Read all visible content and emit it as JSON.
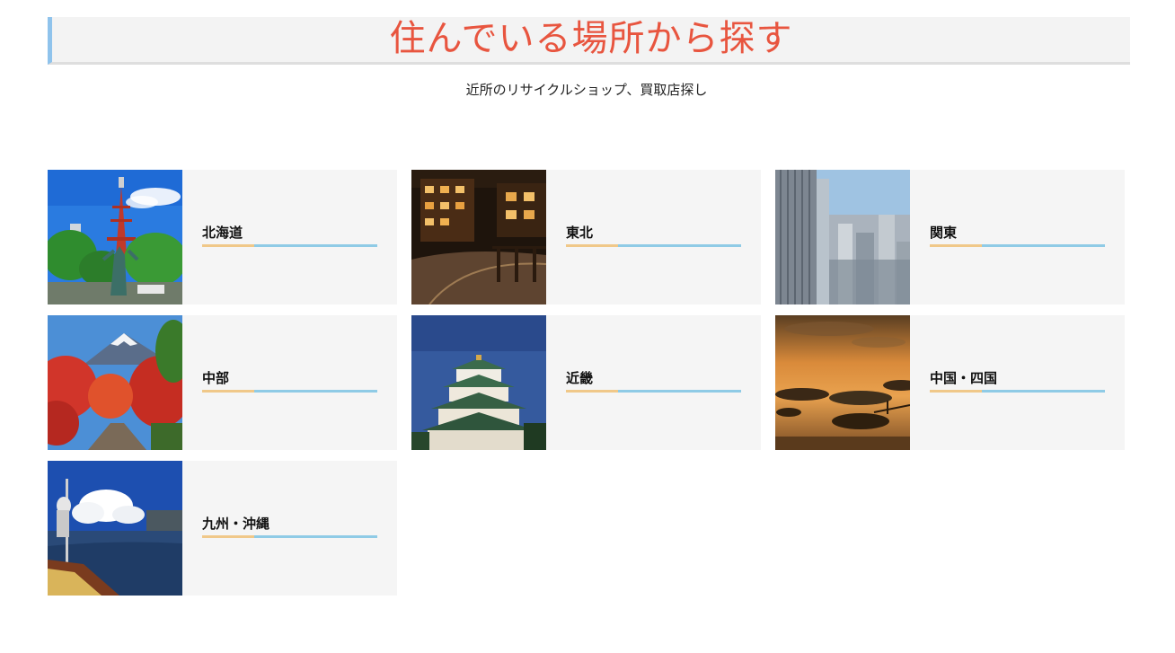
{
  "header": {
    "title": "住んでいる場所から探す",
    "subtitle": "近所のリサイクルショップ、買取店探し"
  },
  "colors": {
    "title": "#e8553f",
    "heading_border": "#8fc3ec",
    "underline_blue": "#8fcbe6",
    "underline_orange": "#f0c889",
    "card_bg": "#f5f5f5"
  },
  "regions": [
    {
      "label": "北海道",
      "thumbnail": "sapporo-tv-tower-photo"
    },
    {
      "label": "東北",
      "thumbnail": "ginzan-onsen-night-photo"
    },
    {
      "label": "関東",
      "thumbnail": "tokyo-skyscrapers-photo"
    },
    {
      "label": "中部",
      "thumbnail": "mount-fuji-autumn-photo"
    },
    {
      "label": "近畿",
      "thumbnail": "osaka-castle-photo"
    },
    {
      "label": "中国・四国",
      "thumbnail": "seto-inland-sea-sunset-photo"
    },
    {
      "label": "九州・沖縄",
      "thumbnail": "yanagawa-boat-ride-photo"
    }
  ]
}
